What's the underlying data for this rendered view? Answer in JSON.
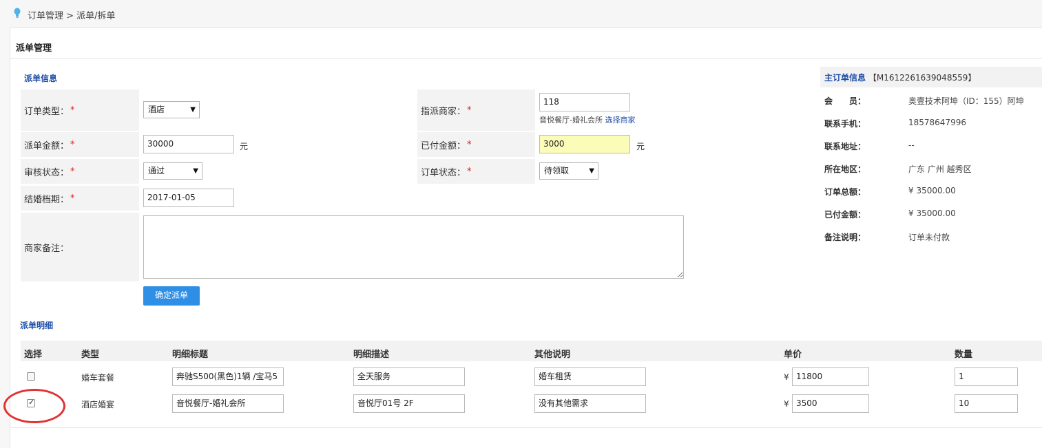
{
  "breadcrumb": {
    "text": "订单管理 > 派单/拆单"
  },
  "page": {
    "title": "派单管理"
  },
  "dispatch_info": {
    "section_title": "派单信息",
    "order_type": {
      "label": "订单类型：",
      "value": "酒店"
    },
    "amount": {
      "label": "派单金额：",
      "value": "30000",
      "unit": "元"
    },
    "review_status": {
      "label": "审核状态：",
      "value": "通过"
    },
    "wedding_date": {
      "label": "结婚档期：",
      "value": "2017-01-05"
    },
    "merchant_note": {
      "label": "商家备注："
    },
    "merchant": {
      "label": "指派商家：",
      "value": "118",
      "name": "音悦餐厅-婚礼会所",
      "select_link": "选择商家"
    },
    "paid_amount": {
      "label": "已付金额：",
      "value": "3000",
      "unit": "元"
    },
    "order_status": {
      "label": "订单状态：",
      "value": "待领取"
    },
    "required_mark": "*",
    "confirm_button": "确定派单"
  },
  "main_order": {
    "title": "主订单信息",
    "order_no": "【M1612261639048559】",
    "rows": [
      {
        "key": "会　　员：",
        "value": "奥壹技术阿坤（ID：155）阿坤"
      },
      {
        "key": "联系手机：",
        "value": "18578647996"
      },
      {
        "key": "联系地址：",
        "value": "--"
      },
      {
        "key": "所在地区：",
        "value": "广东 广州 越秀区"
      },
      {
        "key": "订单总额：",
        "value": "¥ 35000.00"
      },
      {
        "key": "已付金额：",
        "value": "¥ 35000.00"
      },
      {
        "key": "备注说明：",
        "value": "订单未付款"
      }
    ]
  },
  "details": {
    "section_title": "派单明细",
    "headers": [
      "选择",
      "类型",
      "明细标题",
      "明细描述",
      "其他说明",
      "单价",
      "数量"
    ],
    "currency": "¥",
    "rows": [
      {
        "checked": false,
        "type": "婚车套餐",
        "title": "奔驰S500(黑色)1辆 /宝马5",
        "desc": " 全天服务",
        "other": "婚车租赁",
        "price": "11800",
        "qty": "1"
      },
      {
        "checked": true,
        "type": "酒店婚宴",
        "title": "音悦餐厅-婚礼会所",
        "desc": "音悦厅01号 2F",
        "other": "没有其他需求",
        "price": "3500",
        "qty": "10"
      }
    ]
  },
  "colors": {
    "accent": "#1f4ea8",
    "button": "#2f8ee5",
    "required": "#d9251d",
    "highlight": "#fcfcb9",
    "annotation": "#e23232"
  }
}
